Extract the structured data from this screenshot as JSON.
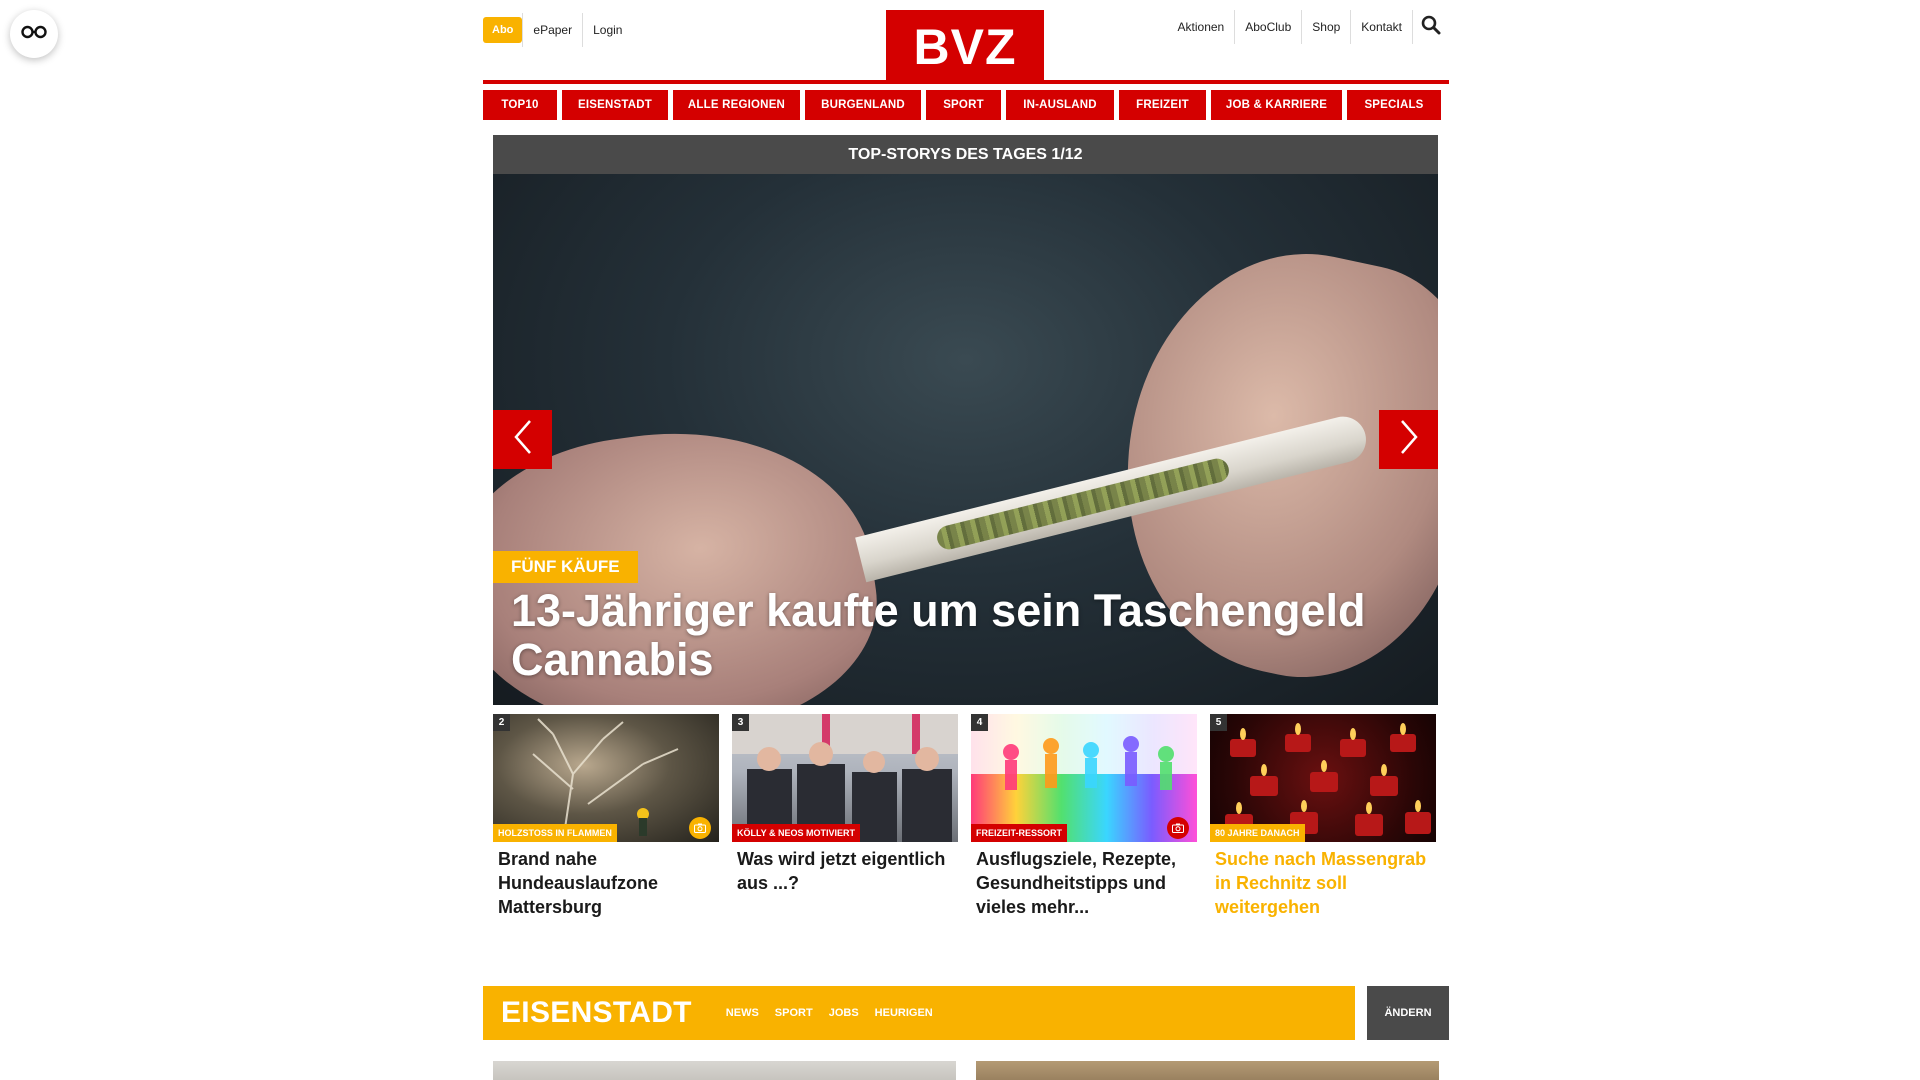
{
  "colors": {
    "brand_red": "#d40000",
    "accent_yellow": "#f9b200",
    "dark_gray": "#4a4a4a"
  },
  "accessibility": {
    "icon": "glasses-icon"
  },
  "header": {
    "abo_label": "Abo",
    "left_links": [
      "ePaper",
      "Login"
    ],
    "logo": "BVZ",
    "right_links": [
      "Aktionen",
      "AboClub",
      "Shop",
      "Kontakt"
    ],
    "search_icon": "search-icon"
  },
  "nav": [
    "TOP10",
    "EISENSTADT",
    "ALLE REGIONEN",
    "BURGENLAND",
    "SPORT",
    "IN-AUSLAND",
    "FREIZEIT",
    "JOB & KARRIERE",
    "SPECIALS"
  ],
  "hero": {
    "header": "TOP-STORYS DES TAGES 1/12",
    "kicker": "FÜNF KÄUFE",
    "title": "13-Jähriger kaufte um sein Taschengeld Cannabis",
    "prev_icon": "chevron-left-icon",
    "next_icon": "chevron-right-icon"
  },
  "cards": [
    {
      "num": "2",
      "kicker": "HOLZSTOSS IN FLAMMEN",
      "kicker_color": "yellow",
      "title": "Brand nahe Hundeauslaufzone Mattersburg",
      "has_photo_badge": true,
      "badge_color": "yellow"
    },
    {
      "num": "3",
      "kicker": "KÖLLY & NEOS MOTIVIERT",
      "kicker_color": "red",
      "title": "Was wird jetzt eigentlich aus ...?",
      "has_photo_badge": false
    },
    {
      "num": "4",
      "kicker": "FREIZEIT-RESSORT",
      "kicker_color": "red",
      "title": "Ausflugsziele, Rezepte, Gesundheitstipps und vieles mehr...",
      "has_photo_badge": true,
      "badge_color": "red"
    },
    {
      "num": "5",
      "kicker": "80 JAHRE DANACH",
      "kicker_color": "yellow",
      "title": "Suche nach Massengrab in Rechnitz soll weitergehen",
      "has_photo_badge": false
    }
  ],
  "region_section": {
    "title": "EISENSTADT",
    "links": [
      "NEWS",
      "SPORT",
      "JOBS",
      "HEURIGEN"
    ],
    "change_label": "ÄNDERN"
  }
}
